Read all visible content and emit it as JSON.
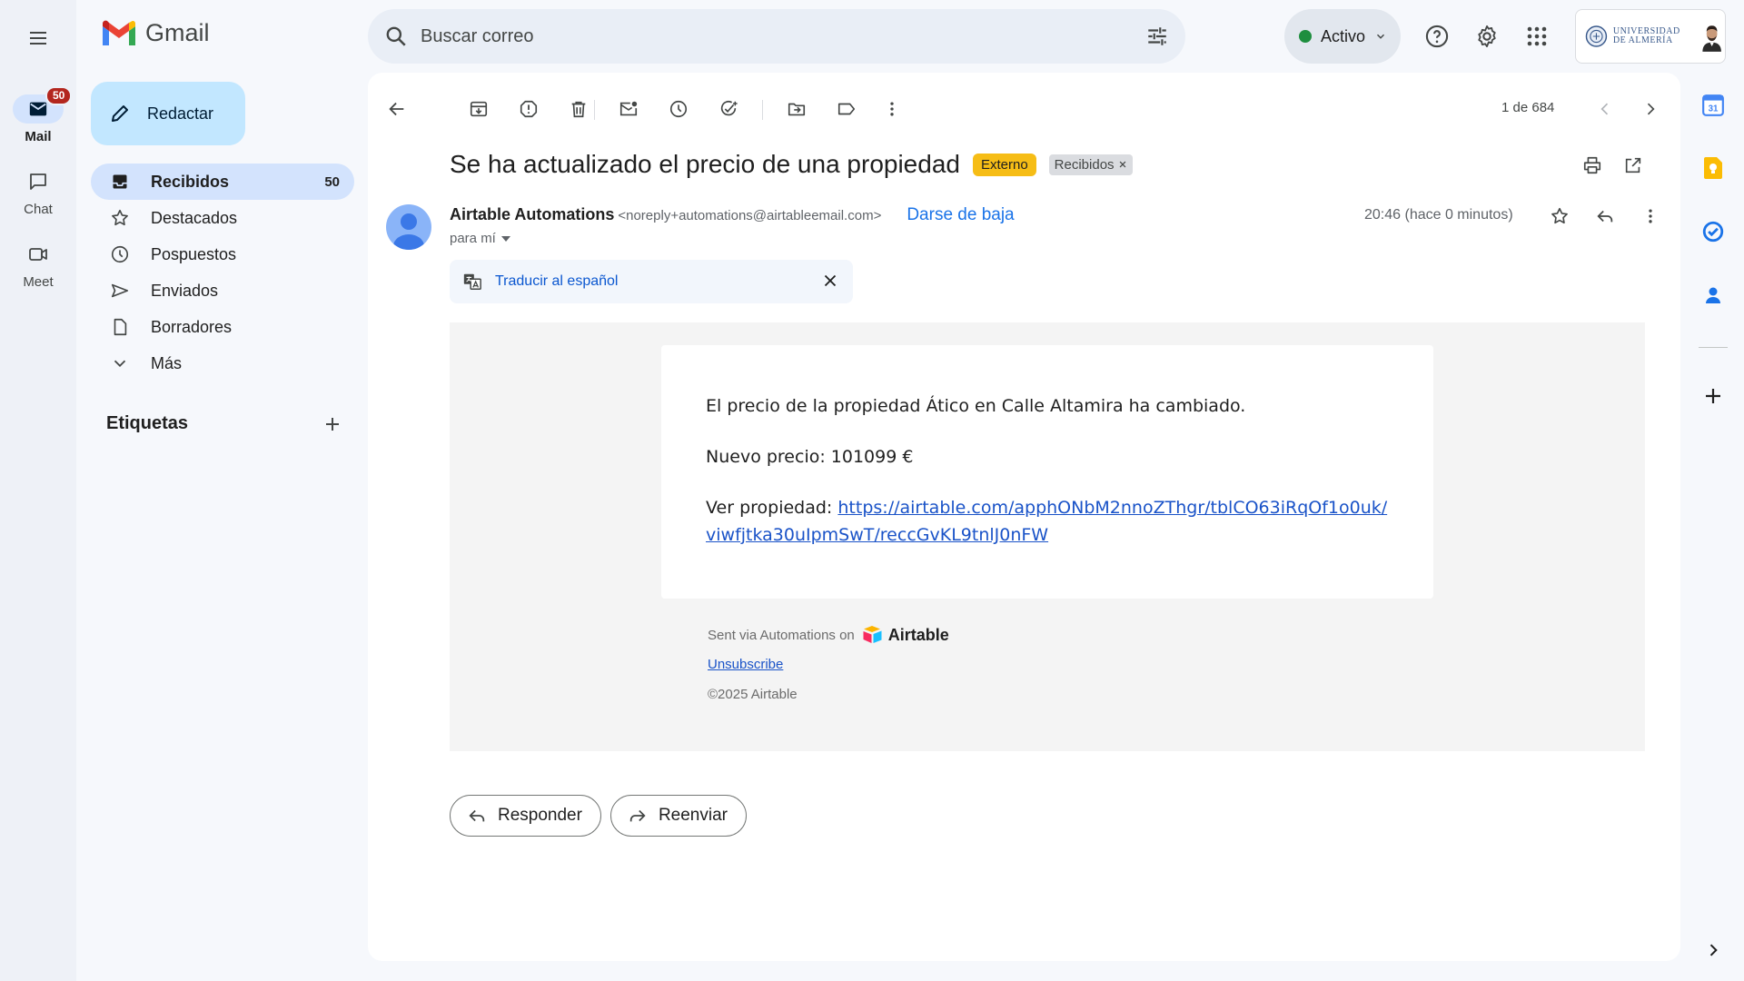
{
  "app": {
    "name": "Gmail"
  },
  "rail": {
    "items": [
      {
        "label": "Mail",
        "badge": "50"
      },
      {
        "label": "Chat"
      },
      {
        "label": "Meet"
      }
    ]
  },
  "compose": {
    "label": "Redactar"
  },
  "nav": {
    "items": [
      {
        "label": "Recibidos",
        "count": "50",
        "icon": "inbox-icon"
      },
      {
        "label": "Destacados",
        "icon": "star-icon"
      },
      {
        "label": "Pospuestos",
        "icon": "clock-icon"
      },
      {
        "label": "Enviados",
        "icon": "send-icon"
      },
      {
        "label": "Borradores",
        "icon": "draft-icon"
      },
      {
        "label": "Más",
        "icon": "chevron-down-icon"
      }
    ],
    "labels_title": "Etiquetas"
  },
  "search": {
    "placeholder": "Buscar correo"
  },
  "status": {
    "label": "Activo",
    "color": "#1e8e3e"
  },
  "account": {
    "org_line1": "UNIVERSIDAD",
    "org_line2": "DE ALMERÍA"
  },
  "toolbar": {
    "pager": "1 de 684"
  },
  "email": {
    "subject": "Se ha actualizado el precio de una propiedad",
    "chips": {
      "external": "Externo",
      "inbox": "Recibidos"
    },
    "sender_name": "Airtable Automations",
    "sender_email": "<noreply+automations@airtableemail.com>",
    "unsubscribe": "Darse de baja",
    "to": "para mí",
    "time": "20:46 (hace 0 minutos)",
    "translate": "Traducir al español",
    "body": {
      "line1": "El precio de la propiedad Ático en Calle Altamira ha cambiado.",
      "line2": "Nuevo precio: 101099 €",
      "line3_prefix": "Ver propiedad: ",
      "link_part1": "https://airtable.com/apphONbM2nnoZThgr/tblCO63iRqOf1o0uk/",
      "link_part2": "viwfjtka30uIpmSwT/reccGvKL9tnlJ0nFW"
    },
    "footer": {
      "sent_via": "Sent via Automations on",
      "brand": "Airtable",
      "unsubscribe": "Unsubscribe",
      "copyright": "©2025 Airtable"
    }
  },
  "actions": {
    "reply": "Responder",
    "forward": "Reenviar"
  },
  "colors": {
    "accent": "#0b57d0",
    "compose_bg": "#c2e7ff",
    "active_nav": "#d3e3fd",
    "external_chip": "#f6bd16"
  }
}
